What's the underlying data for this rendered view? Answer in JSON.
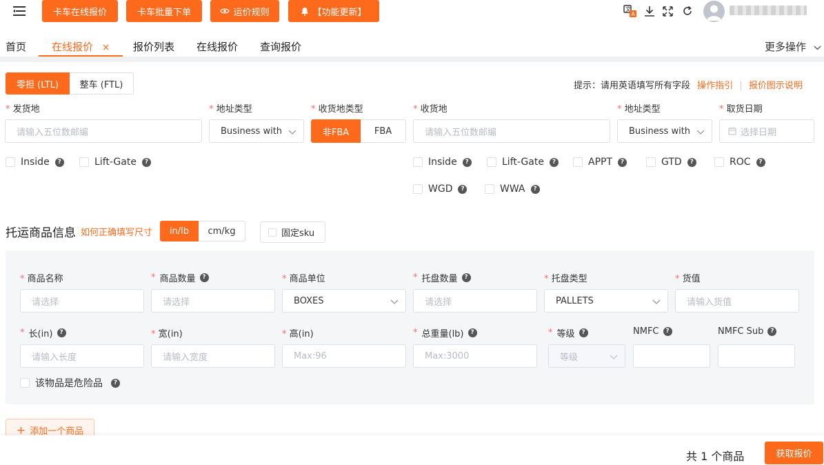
{
  "toolbar": {
    "buttons": [
      {
        "label": "卡车在线报价"
      },
      {
        "label": "卡车批量下单"
      },
      {
        "label": "运价规则"
      },
      {
        "label": "【功能更新】"
      }
    ]
  },
  "tabs": [
    {
      "label": "首页"
    },
    {
      "label": "在线报价",
      "active": true,
      "close": "×"
    },
    {
      "label": "报价列表"
    },
    {
      "label": "在线报价"
    },
    {
      "label": "查询报价"
    }
  ],
  "more_actions": "更多操作",
  "mode": {
    "ltl": "零担 (LTL)",
    "ftl": "整车 (FTL)"
  },
  "hint": {
    "text": "提示：请用英语填写所有字段",
    "guide": "操作指引",
    "sep": "|",
    "illustration": "报价图示说明"
  },
  "origin": {
    "label": "发货地",
    "placeholder": "请输入五位数邮编",
    "addr_type_label": "地址类型",
    "addr_type_value": "Business with",
    "options": [
      {
        "label": "Inside"
      },
      {
        "label": "Lift-Gate"
      }
    ]
  },
  "dest_type": {
    "label": "收货地类型",
    "nonfba": "非FBA",
    "fba": "FBA"
  },
  "dest": {
    "label": "收货地",
    "placeholder": "请输入五位数邮编",
    "addr_type_label": "地址类型",
    "addr_type_value": "Business with",
    "options": [
      {
        "label": "Inside"
      },
      {
        "label": "Lift-Gate"
      },
      {
        "label": "APPT"
      },
      {
        "label": "GTD"
      },
      {
        "label": "ROC"
      },
      {
        "label": "WGD"
      },
      {
        "label": "WWA"
      }
    ]
  },
  "pickup": {
    "label": "取货日期",
    "placeholder": "选择日期"
  },
  "goods": {
    "title": "托运商品信息",
    "howto": "如何正确填写尺寸",
    "unit_imperial": "in/lb",
    "unit_metric": "cm/kg",
    "fixed_sku": "固定sku",
    "fields": {
      "name": {
        "label": "商品名称",
        "placeholder": "请选择"
      },
      "qty": {
        "label": "商品数量",
        "placeholder": "请选择"
      },
      "unit": {
        "label": "商品单位",
        "value": "BOXES"
      },
      "pallet_qty": {
        "label": "托盘数量",
        "placeholder": "请选择"
      },
      "pallet_type": {
        "label": "托盘类型",
        "value": "PALLETS"
      },
      "value": {
        "label": "货值",
        "placeholder": "请输入货值"
      },
      "length": {
        "label": "长(in)",
        "placeholder": "请输入长度"
      },
      "width": {
        "label": "宽(in)",
        "placeholder": "请输入宽度"
      },
      "height": {
        "label": "高(in)",
        "placeholder": "Max:96"
      },
      "weight": {
        "label": "总重量(lb)",
        "placeholder": "Max:3000"
      },
      "grade": {
        "label": "等级",
        "placeholder": "等级"
      },
      "nmfc": {
        "label": "NMFC"
      },
      "nmfc_sub": {
        "label": "NMFC Sub"
      }
    },
    "hazmat": "该物品是危险品",
    "add": "添加一个商品"
  },
  "footer": {
    "count": "共 1 个商品",
    "submit": "获取报价"
  },
  "colors": {
    "accent": "#fe6a1c",
    "required": "#f56c6c",
    "panel": "#f5f6f8"
  }
}
